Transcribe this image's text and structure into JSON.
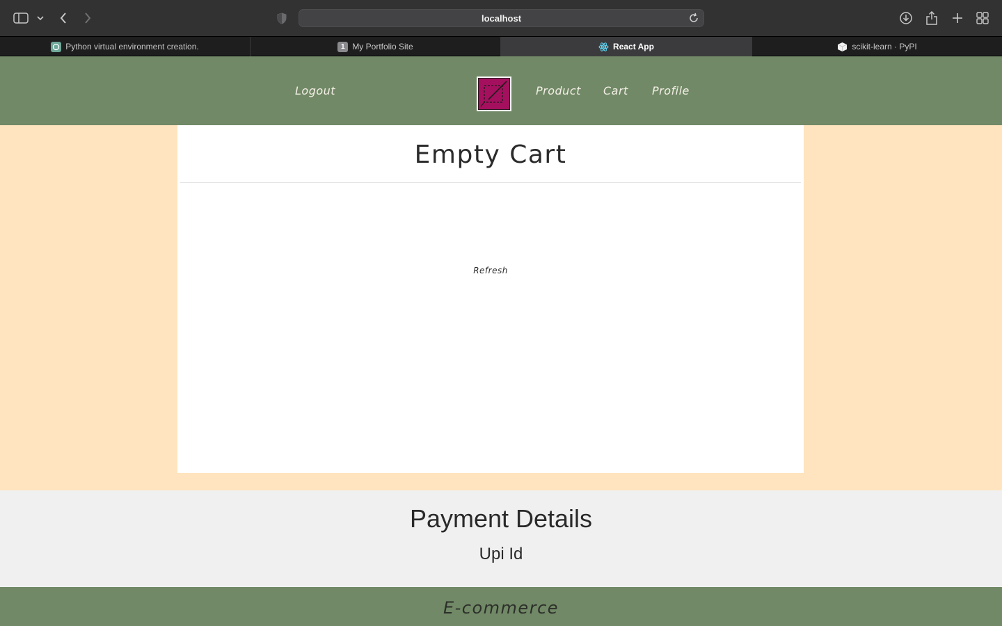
{
  "browser": {
    "url": "localhost",
    "tabs": [
      {
        "label": "Python virtual environment creation.",
        "icon": "openai-icon",
        "active": false
      },
      {
        "label": "My Portfolio Site",
        "icon": "number-badge-icon",
        "badge": "1",
        "active": false
      },
      {
        "label": "React App",
        "icon": "react-icon",
        "active": true
      },
      {
        "label": "scikit-learn · PyPI",
        "icon": "pypi-cube-icon",
        "active": false
      }
    ]
  },
  "nav": {
    "logout": "Logout",
    "product": "Product",
    "cart": "Cart",
    "profile": "Profile"
  },
  "cart": {
    "title": "Empty Cart",
    "refresh": "Refresh"
  },
  "payment": {
    "title": "Payment Details",
    "subtitle": "Upi Id"
  },
  "footer": {
    "text": "E-commerce"
  },
  "colors": {
    "nav_bg": "#718966",
    "page_bg": "#ffe4bf",
    "logo_bg": "#a5105e",
    "payment_bg": "#f0f0f0"
  }
}
